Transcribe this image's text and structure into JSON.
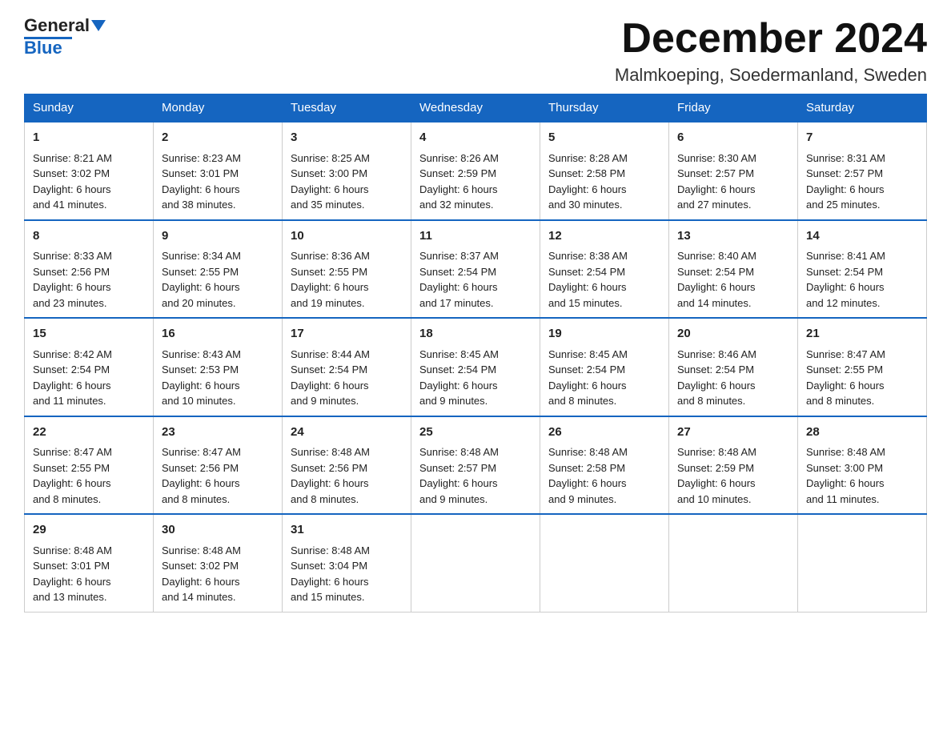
{
  "header": {
    "logo_line1": "General",
    "logo_line2": "Blue",
    "month_title": "December 2024",
    "location": "Malmkoeping, Soedermanland, Sweden"
  },
  "days_of_week": [
    "Sunday",
    "Monday",
    "Tuesday",
    "Wednesday",
    "Thursday",
    "Friday",
    "Saturday"
  ],
  "weeks": [
    [
      {
        "day": "1",
        "info": "Sunrise: 8:21 AM\nSunset: 3:02 PM\nDaylight: 6 hours\nand 41 minutes."
      },
      {
        "day": "2",
        "info": "Sunrise: 8:23 AM\nSunset: 3:01 PM\nDaylight: 6 hours\nand 38 minutes."
      },
      {
        "day": "3",
        "info": "Sunrise: 8:25 AM\nSunset: 3:00 PM\nDaylight: 6 hours\nand 35 minutes."
      },
      {
        "day": "4",
        "info": "Sunrise: 8:26 AM\nSunset: 2:59 PM\nDaylight: 6 hours\nand 32 minutes."
      },
      {
        "day": "5",
        "info": "Sunrise: 8:28 AM\nSunset: 2:58 PM\nDaylight: 6 hours\nand 30 minutes."
      },
      {
        "day": "6",
        "info": "Sunrise: 8:30 AM\nSunset: 2:57 PM\nDaylight: 6 hours\nand 27 minutes."
      },
      {
        "day": "7",
        "info": "Sunrise: 8:31 AM\nSunset: 2:57 PM\nDaylight: 6 hours\nand 25 minutes."
      }
    ],
    [
      {
        "day": "8",
        "info": "Sunrise: 8:33 AM\nSunset: 2:56 PM\nDaylight: 6 hours\nand 23 minutes."
      },
      {
        "day": "9",
        "info": "Sunrise: 8:34 AM\nSunset: 2:55 PM\nDaylight: 6 hours\nand 20 minutes."
      },
      {
        "day": "10",
        "info": "Sunrise: 8:36 AM\nSunset: 2:55 PM\nDaylight: 6 hours\nand 19 minutes."
      },
      {
        "day": "11",
        "info": "Sunrise: 8:37 AM\nSunset: 2:54 PM\nDaylight: 6 hours\nand 17 minutes."
      },
      {
        "day": "12",
        "info": "Sunrise: 8:38 AM\nSunset: 2:54 PM\nDaylight: 6 hours\nand 15 minutes."
      },
      {
        "day": "13",
        "info": "Sunrise: 8:40 AM\nSunset: 2:54 PM\nDaylight: 6 hours\nand 14 minutes."
      },
      {
        "day": "14",
        "info": "Sunrise: 8:41 AM\nSunset: 2:54 PM\nDaylight: 6 hours\nand 12 minutes."
      }
    ],
    [
      {
        "day": "15",
        "info": "Sunrise: 8:42 AM\nSunset: 2:54 PM\nDaylight: 6 hours\nand 11 minutes."
      },
      {
        "day": "16",
        "info": "Sunrise: 8:43 AM\nSunset: 2:53 PM\nDaylight: 6 hours\nand 10 minutes."
      },
      {
        "day": "17",
        "info": "Sunrise: 8:44 AM\nSunset: 2:54 PM\nDaylight: 6 hours\nand 9 minutes."
      },
      {
        "day": "18",
        "info": "Sunrise: 8:45 AM\nSunset: 2:54 PM\nDaylight: 6 hours\nand 9 minutes."
      },
      {
        "day": "19",
        "info": "Sunrise: 8:45 AM\nSunset: 2:54 PM\nDaylight: 6 hours\nand 8 minutes."
      },
      {
        "day": "20",
        "info": "Sunrise: 8:46 AM\nSunset: 2:54 PM\nDaylight: 6 hours\nand 8 minutes."
      },
      {
        "day": "21",
        "info": "Sunrise: 8:47 AM\nSunset: 2:55 PM\nDaylight: 6 hours\nand 8 minutes."
      }
    ],
    [
      {
        "day": "22",
        "info": "Sunrise: 8:47 AM\nSunset: 2:55 PM\nDaylight: 6 hours\nand 8 minutes."
      },
      {
        "day": "23",
        "info": "Sunrise: 8:47 AM\nSunset: 2:56 PM\nDaylight: 6 hours\nand 8 minutes."
      },
      {
        "day": "24",
        "info": "Sunrise: 8:48 AM\nSunset: 2:56 PM\nDaylight: 6 hours\nand 8 minutes."
      },
      {
        "day": "25",
        "info": "Sunrise: 8:48 AM\nSunset: 2:57 PM\nDaylight: 6 hours\nand 9 minutes."
      },
      {
        "day": "26",
        "info": "Sunrise: 8:48 AM\nSunset: 2:58 PM\nDaylight: 6 hours\nand 9 minutes."
      },
      {
        "day": "27",
        "info": "Sunrise: 8:48 AM\nSunset: 2:59 PM\nDaylight: 6 hours\nand 10 minutes."
      },
      {
        "day": "28",
        "info": "Sunrise: 8:48 AM\nSunset: 3:00 PM\nDaylight: 6 hours\nand 11 minutes."
      }
    ],
    [
      {
        "day": "29",
        "info": "Sunrise: 8:48 AM\nSunset: 3:01 PM\nDaylight: 6 hours\nand 13 minutes."
      },
      {
        "day": "30",
        "info": "Sunrise: 8:48 AM\nSunset: 3:02 PM\nDaylight: 6 hours\nand 14 minutes."
      },
      {
        "day": "31",
        "info": "Sunrise: 8:48 AM\nSunset: 3:04 PM\nDaylight: 6 hours\nand 15 minutes."
      },
      {
        "day": "",
        "info": ""
      },
      {
        "day": "",
        "info": ""
      },
      {
        "day": "",
        "info": ""
      },
      {
        "day": "",
        "info": ""
      }
    ]
  ]
}
